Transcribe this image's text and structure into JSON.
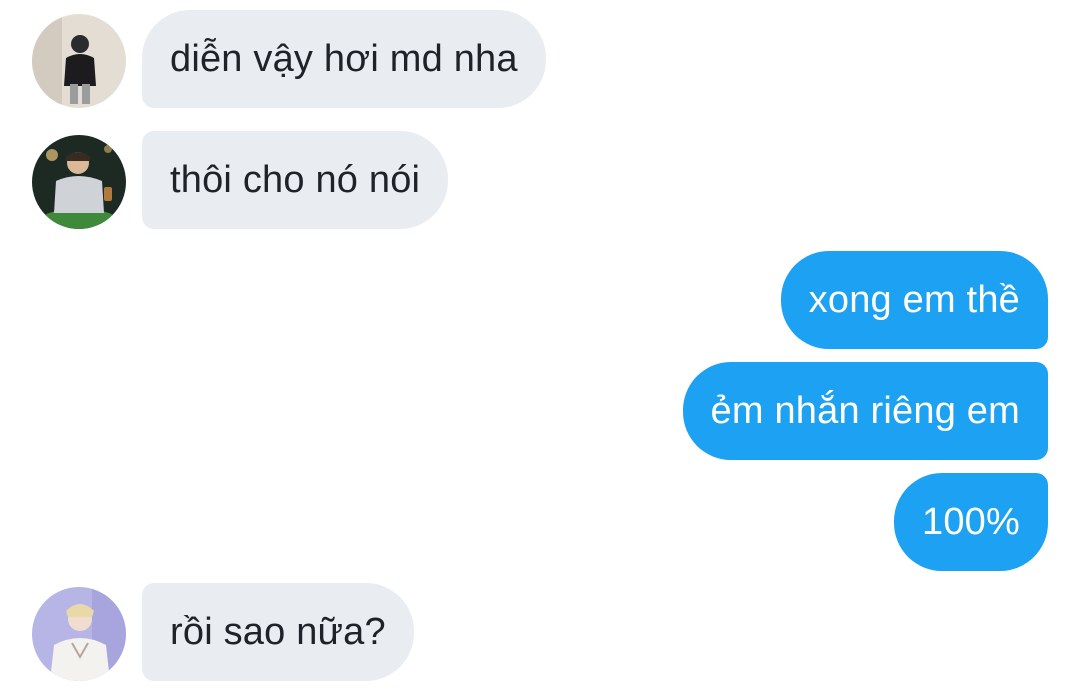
{
  "messages": [
    {
      "direction": "incoming",
      "text": "diễn vậy hơi md nha",
      "avatar": "avatar-person-black-jacket"
    },
    {
      "direction": "incoming",
      "text": "thôi cho nó nói",
      "avatar": "avatar-person-night-outdoor"
    },
    {
      "direction": "outgoing",
      "text": "xong em thề"
    },
    {
      "direction": "outgoing",
      "text": "ẻm nhắn riêng em"
    },
    {
      "direction": "outgoing",
      "text": "100%"
    },
    {
      "direction": "incoming",
      "text": "rồi sao nữa?",
      "avatar": "avatar-person-purple-light"
    }
  ],
  "colors": {
    "incoming_bubble": "#e9edf1",
    "incoming_text": "#1f2329",
    "outgoing_bubble": "#1da1f2",
    "outgoing_text": "#ffffff",
    "background": "#ffffff"
  }
}
